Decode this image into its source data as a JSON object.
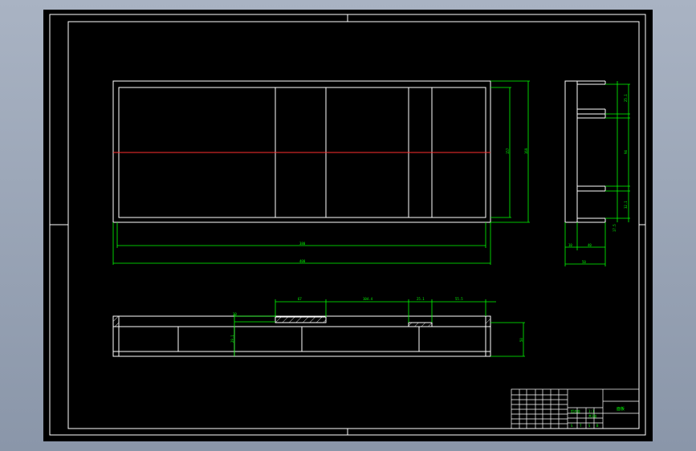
{
  "drawing": {
    "background_color": "#000000",
    "line_color": "#ffffff",
    "dimension_color": "#00ff00",
    "centerline_color": "#ff0000",
    "frame": "outer-sheet-border-and-inner-frame"
  },
  "dims": {
    "front_inner_width": "380",
    "front_outer_width": "400",
    "front_inner_height": "157",
    "front_outer_height": "169",
    "side_t1": "25.1",
    "side_mid": "94",
    "side_t2": "32.1",
    "side_bot": "17.5",
    "side_w1": "10",
    "side_w2": "40",
    "side_w3": "50",
    "top_seg1": "67",
    "top_seg2": "104.4",
    "top_seg3": "25.1",
    "top_seg4": "55.5",
    "top_left_h": "30",
    "top_inner_h": "29.1",
    "top_height": "50"
  },
  "title_block": {
    "drawing_name": "面板",
    "material_label": "铝合金",
    "scale": "1:1",
    "sheet": "共1张",
    "footer_letters": [
      "S",
      "T",
      "S",
      "B"
    ]
  }
}
